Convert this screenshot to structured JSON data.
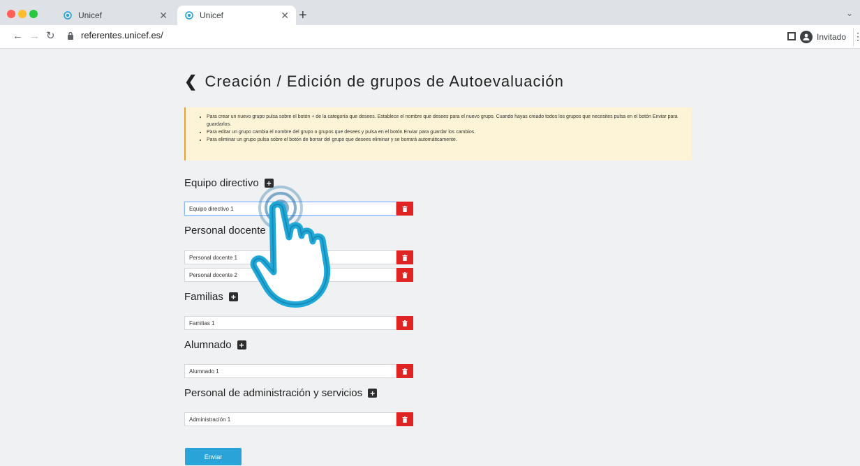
{
  "browser": {
    "tabs": [
      {
        "title": "Unicef"
      },
      {
        "title": "Unicef"
      }
    ],
    "url": "referentes.unicef.es/",
    "profile_label": "Invitado"
  },
  "page": {
    "title": "Creación / Edición de grupos de Autoevaluación",
    "instructions": [
      "Para crear un nuevo grupo pulsa sobre el botón + de la categoría que desees. Establece el nombre que desees para el nuevo grupo. Cuando hayas creado todos los grupos que necesites pulsa en el botón Enviar para guardarlos.",
      "Para editar un grupo cambia el nombre del grupo o grupos que desees y pulsa en el botón Enviar para guardar los cambios.",
      "Para eliminar un grupo pulsa sobre el botón de borrar del grupo que desees eliminar y se borrará automáticamente."
    ],
    "sections": [
      {
        "label": "Equipo directivo",
        "groups": [
          "Equipo directivo 1"
        ]
      },
      {
        "label": "Personal docente",
        "groups": [
          "Personal docente 1",
          "Personal docente 2"
        ]
      },
      {
        "label": "Familias",
        "groups": [
          "Familias 1"
        ]
      },
      {
        "label": "Alumnado",
        "groups": [
          "Alumnado 1"
        ]
      },
      {
        "label": "Personal de administración y servicios",
        "groups": [
          "Administración 1"
        ]
      }
    ],
    "submit_label": "Enviar"
  },
  "colors": {
    "accent": "#2aa4d8",
    "delete": "#e02424",
    "notice_bg": "#fdf3d6",
    "notice_border": "#f0a030"
  }
}
